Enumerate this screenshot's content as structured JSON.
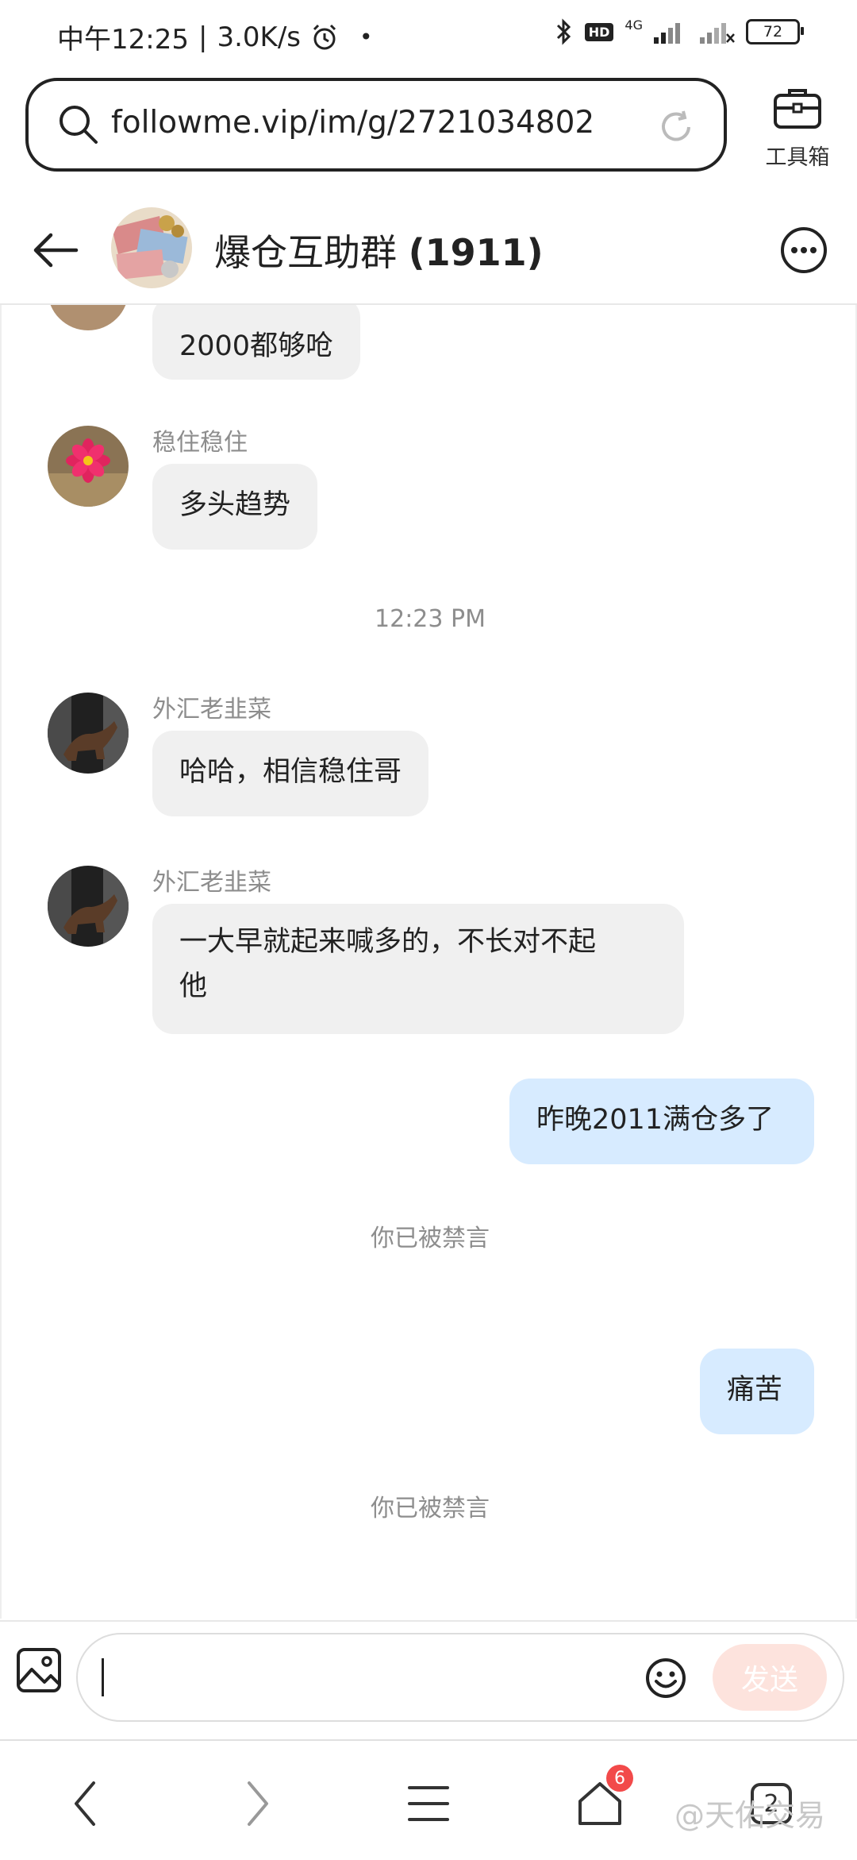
{
  "status": {
    "time": "中午12:25",
    "speed": "3.0K/s",
    "network": "4G",
    "hd": "HD",
    "battery": "72"
  },
  "browser": {
    "url": "followme.vip/im/g/2721034802",
    "toolbox_label": "工具箱"
  },
  "chat": {
    "title": "爆仓互助群",
    "member_count": "(1911)"
  },
  "messages": {
    "m0": {
      "text": "2000都够呛"
    },
    "m1": {
      "sender": "稳住稳住",
      "text": "多头趋势"
    },
    "time_divider": "12:23 PM",
    "m2": {
      "sender": "外汇老韭菜",
      "text": "哈哈，相信稳住哥"
    },
    "m3": {
      "sender": "外汇老韭菜",
      "line1": "一大早就起来喊多的，不长对不起",
      "line2": "他"
    },
    "m4": {
      "text": "昨晚2011满仓多了"
    },
    "note1": "你已被禁言",
    "m5": {
      "text": "痛苦"
    },
    "note2": "你已被禁言"
  },
  "input": {
    "send_label": "发送"
  },
  "nav": {
    "home_badge": "6",
    "tabs_count": "2"
  },
  "watermark": "@天佑交易"
}
